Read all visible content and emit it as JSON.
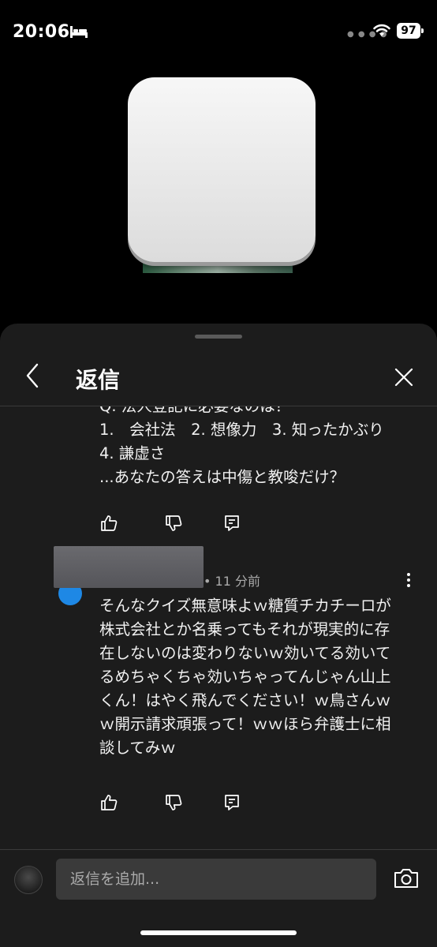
{
  "status_bar": {
    "time": "20:06",
    "battery": "97"
  },
  "panel": {
    "title": "返信"
  },
  "comments": [
    {
      "text": "Q. 法人登記に必要なのは？\n1.　会社法　2. 想像力　3. 知ったかぶり　4. 謙虚さ\n...あなたの答えは中傷と教唆だけ？"
    },
    {
      "meta": "• 11 分前",
      "text": "そんなクイズ無意味よｗ糖質チカチーロが株式会社とか名乗ってもそれが現実的に存在しないのは変わりないｗ効いてる効いてるめちゃくちゃ効いちゃってんじゃん山上くん！はやく飛んでください！ｗ鳥さんｗｗ開示請求頑張って！ｗｗほら弁護士に相談してみｗ"
    }
  ],
  "reply_box": {
    "placeholder": "返信を追加..."
  },
  "colors": {
    "sheet_bg": "#1c1c1c",
    "accent_avatar": "#1e88e5",
    "input_bg": "#3a3a3a"
  }
}
